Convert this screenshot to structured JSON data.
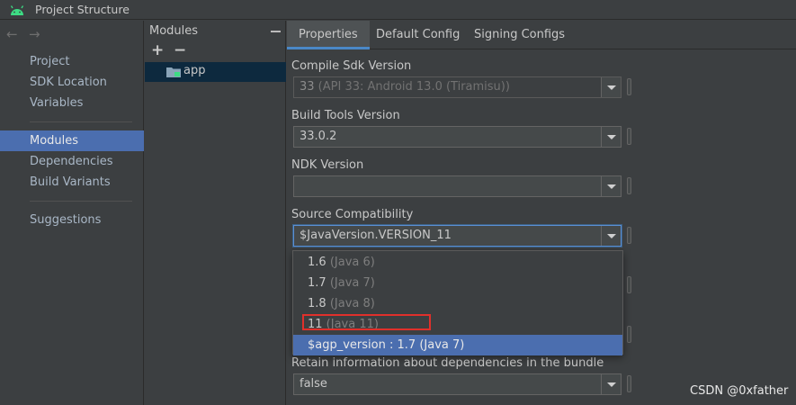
{
  "window": {
    "title": "Project Structure"
  },
  "leftnav": {
    "items": [
      {
        "label": "Project"
      },
      {
        "label": "SDK Location"
      },
      {
        "label": "Variables"
      },
      {
        "label": "Modules"
      },
      {
        "label": "Dependencies"
      },
      {
        "label": "Build Variants"
      },
      {
        "label": "Suggestions"
      }
    ],
    "active": "Modules"
  },
  "modules": {
    "header": "Modules",
    "add_label": "+",
    "remove_label": "−",
    "items": [
      {
        "label": "app"
      }
    ]
  },
  "tabs": [
    {
      "label": "Properties"
    },
    {
      "label": "Default Config"
    },
    {
      "label": "Signing Configs"
    }
  ],
  "fields": {
    "compile_sdk": {
      "label": "Compile Sdk Version",
      "value_main": "33",
      "value_hint": " (API 33: Android 13.0 (Tiramisu))"
    },
    "build_tools": {
      "label": "Build Tools Version",
      "value": "33.0.2"
    },
    "ndk": {
      "label": "NDK Version",
      "value": ""
    },
    "source_compat": {
      "label": "Source Compatibility",
      "value": "$JavaVersion.VERSION_11"
    },
    "retain_info": {
      "label": "Retain information about dependencies in the bundle",
      "value": "false"
    }
  },
  "dropdown": {
    "options": [
      {
        "main": "1.6",
        "sub": " (Java 6)"
      },
      {
        "main": "1.7",
        "sub": " (Java 7)"
      },
      {
        "main": "1.8",
        "sub": " (Java 8)"
      },
      {
        "main": "11",
        "sub": " (Java 11)"
      },
      {
        "main": "$agp_version : 1.7",
        "sub": " (Java 7)"
      }
    ],
    "selected_index": 4,
    "highlighted_index": 3
  },
  "watermark": "CSDN @0xfather",
  "colors": {
    "accent": "#4b6eaf",
    "tab_underline": "#4a88c7",
    "highlight_box": "#e0302b",
    "android_green": "#3ddc84"
  }
}
